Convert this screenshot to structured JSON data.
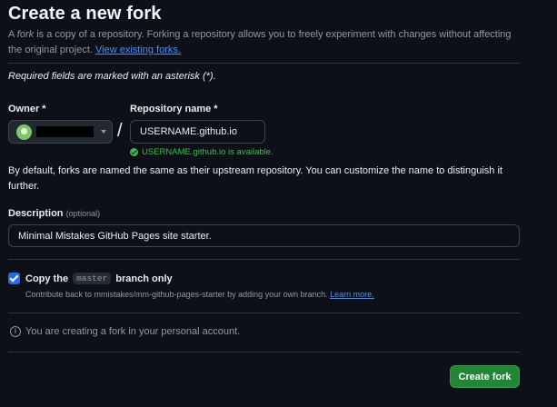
{
  "header": {
    "title": "Create a new fork",
    "intro_prefix": "A ",
    "intro_em": "fork",
    "intro_rest": " is a copy of a repository. Forking a repository allows you to freely experiment with changes without affecting the original project. ",
    "intro_link": "View existing forks."
  },
  "form": {
    "required_note": "Required fields are marked with an asterisk (*).",
    "owner_label": "Owner *",
    "repo_label": "Repository name *",
    "slash": "/",
    "repo_value": "USERNAME.github.io",
    "availability": "USERNAME.github.io is available.",
    "default_note": "By default, forks are named the same as their upstream repository. You can customize the name to distinguish it further.",
    "description_label": "Description",
    "description_optional": "(optional)",
    "description_value": "Minimal Mistakes GitHub Pages site starter.",
    "copy_prefix": "Copy the",
    "copy_branch": "master",
    "copy_suffix": "branch only",
    "copy_checked": true,
    "contrib_text": "Contribute back to mmistakes/mm-github-pages-starter by adding your own branch. ",
    "contrib_link": "Learn more.",
    "info_text": "You are creating a fork in your personal account.",
    "submit_label": "Create fork"
  },
  "icons": {
    "owner_caret": "chevron-down-icon",
    "availability": "check-circle-icon",
    "info": "info-icon"
  },
  "colors": {
    "background": "#0d1117",
    "accent_link": "#4493f8",
    "success": "#3fb950",
    "primary_button": "#238636",
    "checkbox": "#1f6feb"
  }
}
